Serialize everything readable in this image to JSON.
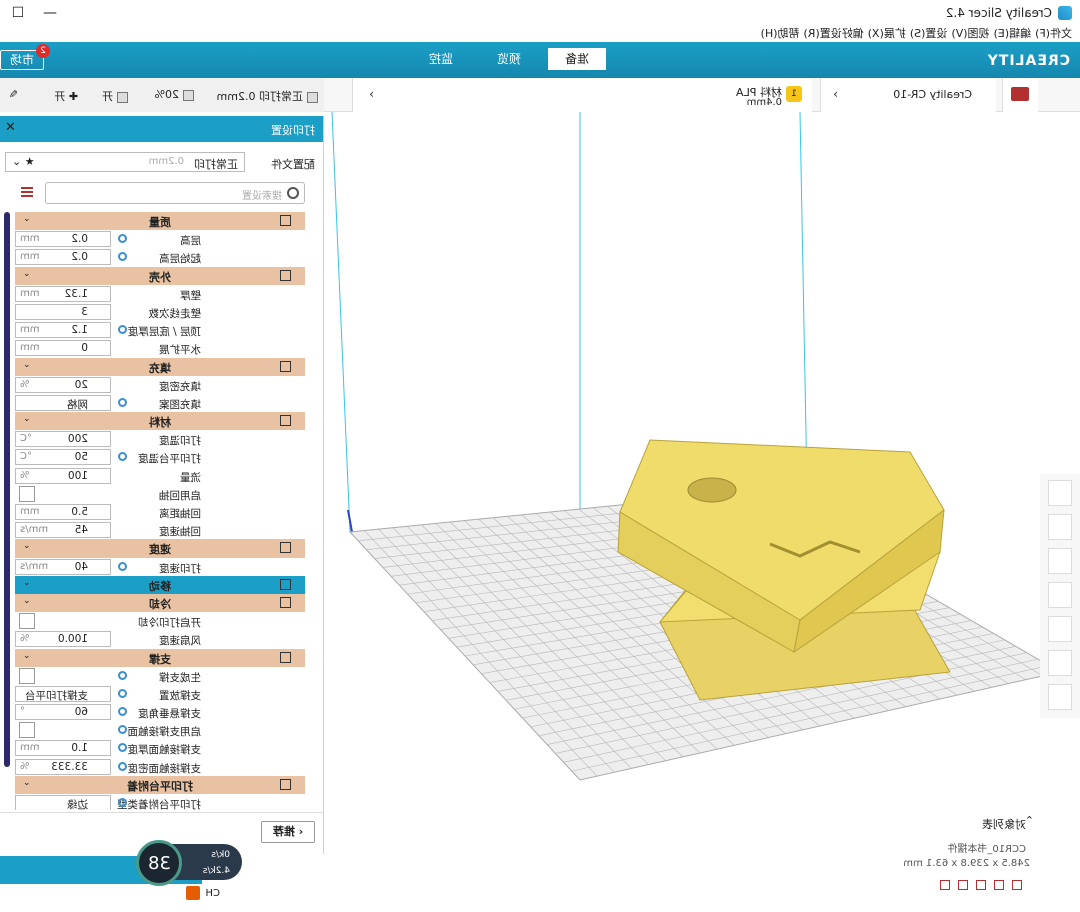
{
  "window": {
    "title": "Creality Slicer 4.2",
    "menu": [
      "文件(F)",
      "编辑(E)",
      "视图(V)",
      "设置(S)",
      "扩展(X)",
      "偏好设置(R)",
      "帮助(H)"
    ]
  },
  "header": {
    "logo": "CREALITY",
    "tabs": [
      "准备",
      "预览",
      "监控"
    ],
    "active_tab": "准备",
    "market_label": "市场",
    "badge_count": "2"
  },
  "toolbar": {
    "printer_name": "Creality CR-10",
    "material_name": "材料 PLA",
    "nozzle": "0.4mm",
    "material_badge": "1",
    "profile_name": "正常打印 0.2mm",
    "infill_pct": "20%",
    "support_label": "开",
    "adhesion_label": "开"
  },
  "panel": {
    "title": "打印设置",
    "profile_label": "配置文件",
    "profile_value": "正常打印",
    "profile_sub": "0.2mm",
    "search_placeholder": "搜索设置",
    "recommend_label": "推荐"
  },
  "settings": [
    {
      "type": "cat",
      "label": "质量"
    },
    {
      "type": "field",
      "label": "层高",
      "value": "0.2",
      "unit": "mm",
      "link": true
    },
    {
      "type": "field",
      "label": "起始层高",
      "value": "0.2",
      "unit": "mm",
      "link": true
    },
    {
      "type": "cat",
      "label": "外壳"
    },
    {
      "type": "field",
      "label": "壁厚",
      "value": "1.32",
      "unit": "mm"
    },
    {
      "type": "field",
      "label": "壁走线次数",
      "value": "3",
      "unit": ""
    },
    {
      "type": "field",
      "label": "顶层 / 底层厚度",
      "value": "1.2",
      "unit": "mm",
      "link": true
    },
    {
      "type": "field",
      "label": "水平扩展",
      "value": "0",
      "unit": "mm"
    },
    {
      "type": "cat",
      "label": "填充"
    },
    {
      "type": "field",
      "label": "填充密度",
      "value": "20",
      "unit": "%"
    },
    {
      "type": "field",
      "label": "填充图案",
      "value": "网格",
      "unit": "",
      "link": true
    },
    {
      "type": "cat",
      "label": "材料"
    },
    {
      "type": "field",
      "label": "打印温度",
      "value": "200",
      "unit": "°C"
    },
    {
      "type": "field",
      "label": "打印平台温度",
      "value": "50",
      "unit": "°C",
      "link": true
    },
    {
      "type": "field",
      "label": "流量",
      "value": "100",
      "unit": "%"
    },
    {
      "type": "check",
      "label": "启用回抽"
    },
    {
      "type": "field",
      "label": "回抽距离",
      "value": "5.0",
      "unit": "mm"
    },
    {
      "type": "field",
      "label": "回抽速度",
      "value": "45",
      "unit": "mm/s"
    },
    {
      "type": "cat",
      "label": "速度"
    },
    {
      "type": "field",
      "label": "打印速度",
      "value": "40",
      "unit": "mm/s",
      "link": true
    },
    {
      "type": "cat",
      "label": "移动",
      "active": true
    },
    {
      "type": "cat",
      "label": "冷却"
    },
    {
      "type": "check",
      "label": "开启打印冷却"
    },
    {
      "type": "field",
      "label": "风扇速度",
      "value": "100.0",
      "unit": "%"
    },
    {
      "type": "cat",
      "label": "支撑"
    },
    {
      "type": "check",
      "label": "生成支撑",
      "link": true
    },
    {
      "type": "field",
      "label": "支撑放置",
      "value": "支撑打印平台",
      "unit": "",
      "link": true
    },
    {
      "type": "field",
      "label": "支撑悬垂角度",
      "value": "60",
      "unit": "°",
      "link": true
    },
    {
      "type": "check",
      "label": "启用支撑接触面",
      "link": true
    },
    {
      "type": "field",
      "label": "支撑接触面厚度",
      "value": "1.0",
      "unit": "mm",
      "link": true
    },
    {
      "type": "field",
      "label": "支撑接触面密度",
      "value": "33.333",
      "unit": "%",
      "link": true
    },
    {
      "type": "cat",
      "label": "打印平台附着"
    },
    {
      "type": "field",
      "label": "打印平台附着类型",
      "value": "边缘",
      "unit": "",
      "link": true
    }
  ],
  "objects": {
    "header": "对象列表",
    "item": "CCR10_书本摆件",
    "dims": "248.5 x 239.8 x 63.1 mm"
  },
  "speed_widget": {
    "percent": "38",
    "up": "0k/s",
    "down": "4.2k/s"
  },
  "status": {
    "ime": "CH"
  }
}
